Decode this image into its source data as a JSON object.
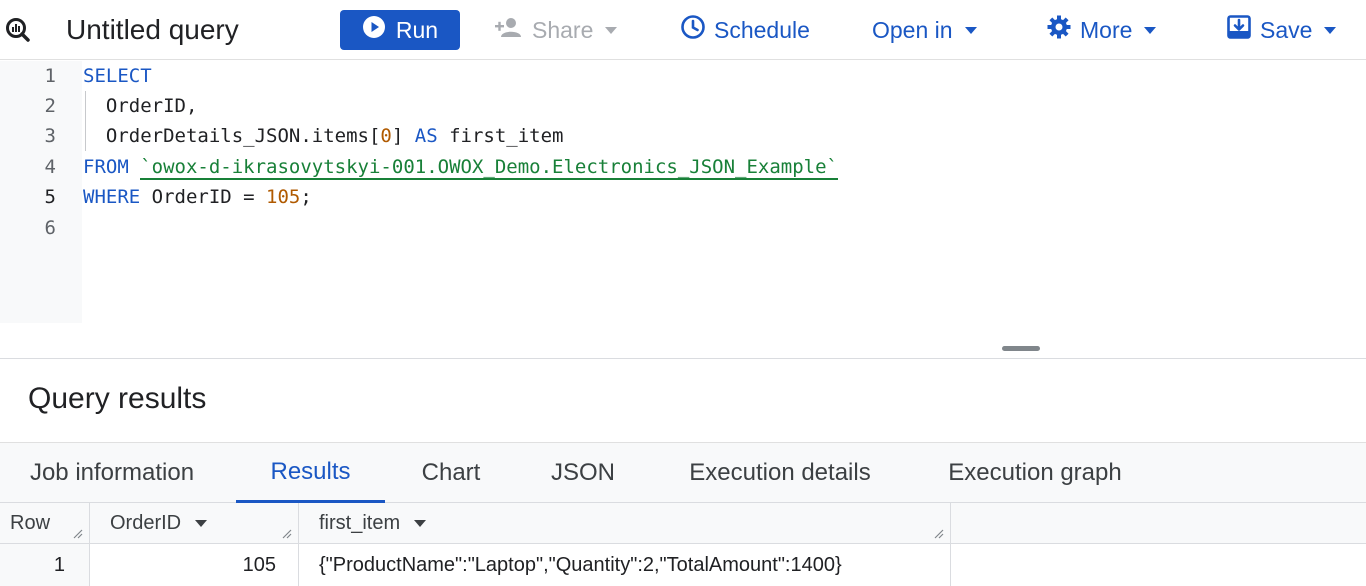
{
  "toolbar": {
    "title": "Untitled query",
    "run_label": "Run",
    "share_label": "Share",
    "schedule_label": "Schedule",
    "open_in_label": "Open in",
    "more_label": "More",
    "save_label": "Save"
  },
  "editor": {
    "line_numbers": [
      "1",
      "2",
      "3",
      "4",
      "5",
      "6"
    ],
    "lines": {
      "l1_kw": "SELECT",
      "l2_text": "  OrderID,",
      "l3_text_a": "  OrderDetails_JSON.items[",
      "l3_num": "0",
      "l3_text_b": "] ",
      "l3_kw": "AS",
      "l3_text_c": " first_item",
      "l4_kw": "FROM",
      "l4_str": "`owox-d-ikrasovytskyi-001.OWOX_Demo.Electronics_JSON_Example`",
      "l5_kw": "WHERE",
      "l5_text": " OrderID = ",
      "l5_num": "105",
      "l5_end": ";"
    }
  },
  "results": {
    "title": "Query results",
    "tabs": [
      {
        "label": "Job information"
      },
      {
        "label": "Results"
      },
      {
        "label": "Chart"
      },
      {
        "label": "JSON"
      },
      {
        "label": "Execution details"
      },
      {
        "label": "Execution graph"
      }
    ],
    "active_tab": "Results",
    "columns": [
      "Row",
      "OrderID",
      "first_item"
    ],
    "rows": [
      {
        "row": "1",
        "order_id": "105",
        "first_item": "{\"ProductName\":\"Laptop\",\"Quantity\":2,\"TotalAmount\":1400}"
      }
    ]
  },
  "icons": {
    "logo": "bigquery-logo-icon",
    "run": "play-circle-icon",
    "share": "person-add-icon",
    "schedule": "clock-icon",
    "more": "gear-icon",
    "save": "save-icon"
  },
  "colors": {
    "accent": "#1a57c4",
    "keyword": "#1a57c4",
    "number": "#b05a00",
    "string": "#188038",
    "disabled": "#a8abb0"
  }
}
